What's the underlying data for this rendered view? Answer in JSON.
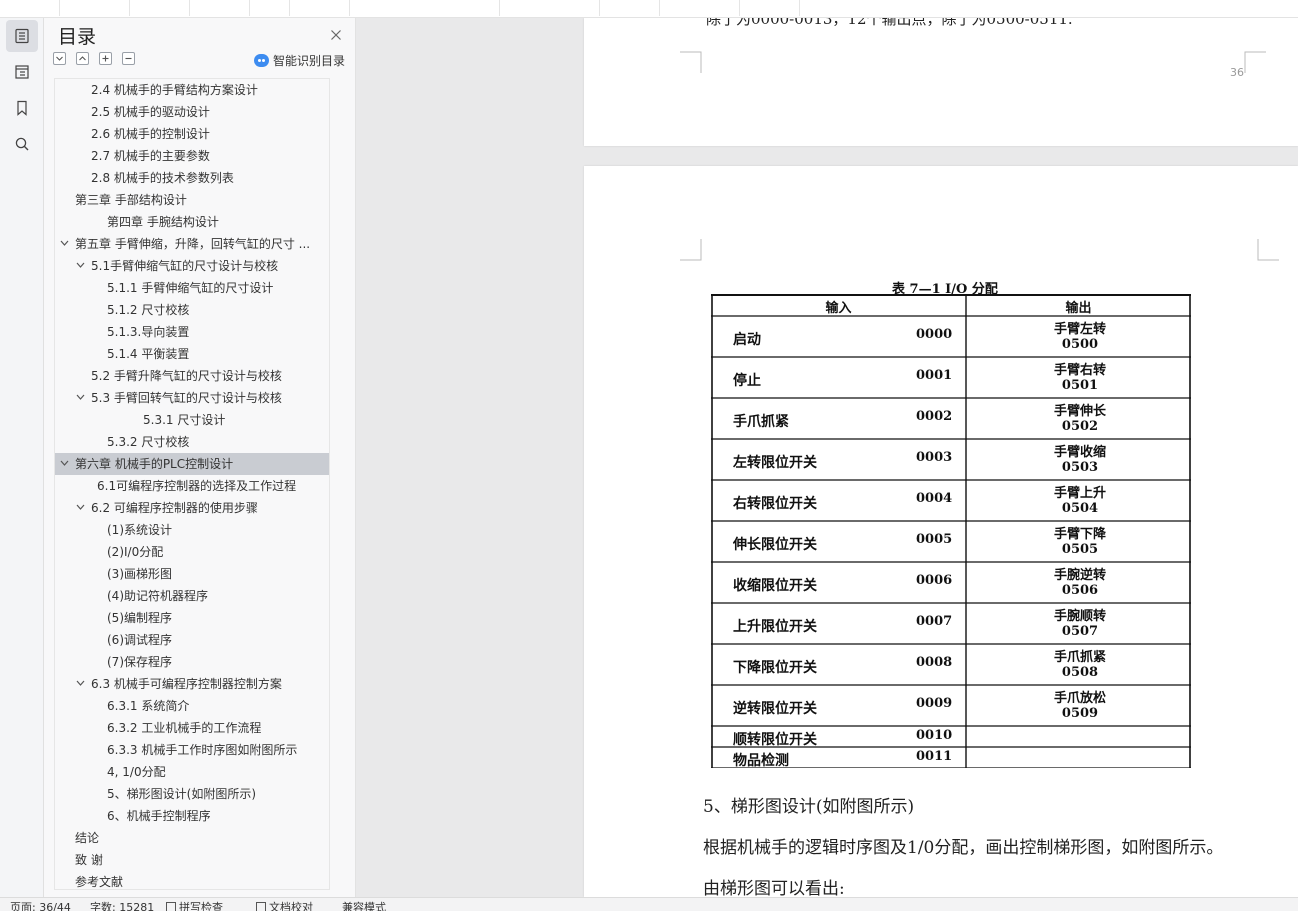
{
  "toolbar": {
    "segments": [
      "",
      "",
      "",
      "",
      "",
      "",
      "",
      "",
      "",
      "",
      ""
    ]
  },
  "toc": {
    "title": "目录",
    "smart_label": "智能识别目录",
    "items": [
      {
        "label": "2.4  机械手的手臂结构方案设计",
        "indent": 2,
        "chev": "none"
      },
      {
        "label": "2.5  机械手的驱动设计",
        "indent": 2,
        "chev": "none"
      },
      {
        "label": "2.6  机械手的控制设计",
        "indent": 2,
        "chev": "none"
      },
      {
        "label": "2.7  机械手的主要参数",
        "indent": 2,
        "chev": "none"
      },
      {
        "label": "2.8  机械手的技术参数列表",
        "indent": 2,
        "chev": "none"
      },
      {
        "label": "第三章   手部结构设计",
        "indent": 1,
        "chev": "none"
      },
      {
        "label": "第四章   手腕结构设计",
        "indent": 3,
        "chev": "none"
      },
      {
        "label": "第五章   手臂伸缩，升降，回转气缸的尺寸 ...",
        "indent": 1,
        "chev": "down"
      },
      {
        "label": "5.1手臂伸缩气缸的尺寸设计与校核",
        "indent": 2,
        "chev": "down"
      },
      {
        "label": "5.1.1  手臂伸缩气缸的尺寸设计",
        "indent": 3,
        "chev": "none"
      },
      {
        "label": "5.1.2  尺寸校核",
        "indent": 3,
        "chev": "none"
      },
      {
        "label": "5.1.3.导向装置",
        "indent": 3,
        "chev": "none"
      },
      {
        "label": "5.1.4  平衡装置",
        "indent": 3,
        "chev": "none"
      },
      {
        "label": "5.2  手臂升降气缸的尺寸设计与校核",
        "indent": 2,
        "chev": "none"
      },
      {
        "label": "5.3  手臂回转气缸的尺寸设计与校核",
        "indent": 2,
        "chev": "down"
      },
      {
        "label": "5.3.1  尺寸设计",
        "indent": 5,
        "chev": "none"
      },
      {
        "label": "5.3.2  尺寸校核",
        "indent": 3,
        "chev": "none"
      },
      {
        "label": "第六章   机械手的PLC控制设计",
        "indent": 1,
        "chev": "down"
      },
      {
        "label": "6.1可编程序控制器的选择及工作过程",
        "indent": 4,
        "chev": "none"
      },
      {
        "label": "6.2  可编程序控制器的使用步骤",
        "indent": 2,
        "chev": "down"
      },
      {
        "label": "(1)系统设计",
        "indent": 3,
        "chev": "none"
      },
      {
        "label": "(2)I/0分配",
        "indent": 3,
        "chev": "none"
      },
      {
        "label": "(3)画梯形图",
        "indent": 3,
        "chev": "none"
      },
      {
        "label": "(4)助记符机器程序",
        "indent": 3,
        "chev": "none"
      },
      {
        "label": "(5)编制程序",
        "indent": 3,
        "chev": "none"
      },
      {
        "label": "(6)调试程序",
        "indent": 3,
        "chev": "none"
      },
      {
        "label": "(7)保存程序",
        "indent": 3,
        "chev": "none"
      },
      {
        "label": "6.3  机械手可编程序控制器控制方案",
        "indent": 2,
        "chev": "down"
      },
      {
        "label": "6.3.1  系统简介",
        "indent": 3,
        "chev": "none"
      },
      {
        "label": "6.3.2  工业机械手的工作流程",
        "indent": 3,
        "chev": "none"
      },
      {
        "label": "6.3.3  机械手工作时序图如附图所示",
        "indent": 3,
        "chev": "none"
      },
      {
        "label": "4, 1/0分配",
        "indent": 3,
        "chev": "none"
      },
      {
        "label": "5、梯形图设计(如附图所示)",
        "indent": 3,
        "chev": "none"
      },
      {
        "label": "6、机械手控制程序",
        "indent": 3,
        "chev": "none"
      },
      {
        "label": "结论",
        "indent": 1,
        "chev": "none"
      },
      {
        "label": "致    谢",
        "indent": 1,
        "chev": "none"
      },
      {
        "label": "参考文献",
        "indent": 1,
        "chev": "none"
      }
    ]
  },
  "document": {
    "page1_cut_text": "除了为0000-0013，12个输出点，除了为0500-0511.",
    "page1_number": "36",
    "table_title": "表 7—1      I/O 分配",
    "header_input": "输入",
    "header_output": "输出",
    "rows": [
      {
        "in_name": "启动",
        "in_code": "0000",
        "out_name": "手臂左转",
        "out_code": "0500"
      },
      {
        "in_name": "停止",
        "in_code": "0001",
        "out_name": "手臂右转",
        "out_code": "0501"
      },
      {
        "in_name": "手爪抓紧",
        "in_code": "0002",
        "out_name": "手臂伸长",
        "out_code": "0502"
      },
      {
        "in_name": "左转限位开关",
        "in_code": "0003",
        "out_name": "手臂收缩",
        "out_code": "0503"
      },
      {
        "in_name": "右转限位开关",
        "in_code": "0004",
        "out_name": "手臂上升",
        "out_code": "0504"
      },
      {
        "in_name": "伸长限位开关",
        "in_code": "0005",
        "out_name": "手臂下降",
        "out_code": "0505"
      },
      {
        "in_name": "收缩限位开关",
        "in_code": "0006",
        "out_name": "手腕逆转",
        "out_code": "0506"
      },
      {
        "in_name": "上升限位开关",
        "in_code": "0007",
        "out_name": "手腕顺转",
        "out_code": "0507"
      },
      {
        "in_name": "下降限位开关",
        "in_code": "0008",
        "out_name": "手爪抓紧",
        "out_code": "0508"
      },
      {
        "in_name": "逆转限位开关",
        "in_code": "0009",
        "out_name": "手爪放松",
        "out_code": "0509"
      },
      {
        "in_name": "顺转限位开关",
        "in_code": "0010",
        "out_name": "",
        "out_code": ""
      },
      {
        "in_name": "物品检测",
        "in_code": "0011",
        "out_name": "",
        "out_code": ""
      }
    ],
    "para1": "5、梯形图设计(如附图所示)",
    "para2": "根据机械手的逻辑时序图及1/0分配，画出控制梯形图，如附图所示。",
    "para3": "由梯形图可以看出:"
  },
  "status": {
    "page": "页面: 36/44",
    "words": "字数: 15281",
    "spell": "拼写检查",
    "proof": "文档校对",
    "compat": "兼容模式"
  }
}
